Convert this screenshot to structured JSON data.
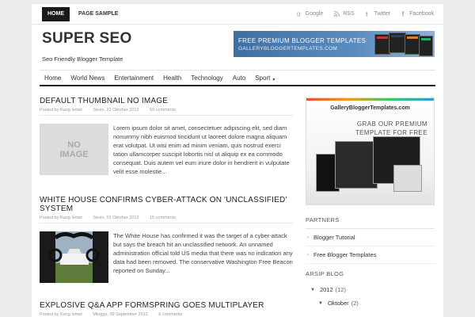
{
  "topnav": [
    {
      "label": "HOME",
      "active": true
    },
    {
      "label": "PAGE SAMPLE",
      "active": false
    }
  ],
  "social": [
    {
      "icon": "google-icon",
      "label": "Google"
    },
    {
      "icon": "rss-icon",
      "label": "RSS"
    },
    {
      "icon": "twitter-icon",
      "label": "Twitter"
    },
    {
      "icon": "facebook-icon",
      "label": "Facebook"
    }
  ],
  "blog": {
    "title": "SUPER SEO",
    "tagline": "Seo Friendly Blogger Template"
  },
  "banner": {
    "line1": "FREE PREMIUM BLOGGER TEMPLATES",
    "line2": "GALLERYBLOGGERTEMPLATES.COM"
  },
  "mainnav": [
    "Home",
    "World News",
    "Entertainment",
    "Health",
    "Technology",
    "Auto",
    "Sport"
  ],
  "posts": [
    {
      "title": "DEFAULT THUMBNAIL NO IMAGE",
      "author": "Posted by Kang Ismet",
      "date": "Senin, 22 Oktober 2012",
      "comments": "50 comments",
      "thumb_text": "NO IMAGE",
      "excerpt": "Lorem ipsum dolor sit amet, consectetuer adipiscing elit, sed diam nonummy nibh euismod tincidunt ut laoreet dolore magna aliquam erat volutpat. Ut wisi enim ad minim veniam, quis nostrud exerci tation ullamcorper suscipit lobortis nisl ut aliquip ex ea commodo consequat. Duis autem vel eum iriure dolor in hendrerit in vulputate velit esse molestie..."
    },
    {
      "title": "WHITE HOUSE CONFIRMS CYBER-ATTACK ON 'UNCLASSIFIED' SYSTEM",
      "author": "Posted by Kang Ismet",
      "date": "Senin, 01 Oktober 2012",
      "comments": "15 comments",
      "excerpt": "The White House has confirmed it was the target of a cyber-attack but says the breach hit an unclassified network. An unnamed administration official told US media that there was no indication any data had been removed. The conservative Washington Free Beacon reported on Sunday..."
    },
    {
      "title": "EXPLOSIVE Q&A APP FORMSPRING GOES MULTIPLAYER",
      "author": "Posted by Kang Ismet",
      "date": "Minggu, 09 September 2012",
      "comments": "6 comments"
    }
  ],
  "sidebar": {
    "ad_site": "GalleryBloggerTemplates.com",
    "ad_text": "GRAB OUR PREMIUM TEMPLATE FOR FREE",
    "partners_heading": "PARTNERS",
    "partners": [
      "Blogger Tutorial",
      "Free Blogger Templates"
    ],
    "archive_heading": "ARSIP BLOG",
    "archive": [
      {
        "label": "2012",
        "count": "(12)"
      },
      {
        "label": "Oktober",
        "count": "(2)"
      }
    ]
  }
}
